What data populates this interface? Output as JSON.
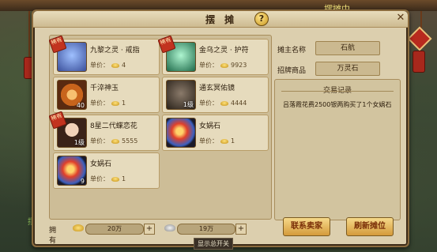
{
  "scene": {
    "top_text": "摆摊中",
    "bottom_text": "摆摊"
  },
  "panel": {
    "title": "摆 摊",
    "help_label": "?",
    "close_label": "✕"
  },
  "labels": {
    "price_label": "单价：",
    "rare_tag": "稀有"
  },
  "items": [
    {
      "name": "九黎之灵 · 戒指",
      "price": "4",
      "count": "",
      "rare": true,
      "icon_color": "#5b7ec9"
    },
    {
      "name": "金乌之灵 · 护符",
      "price": "9923",
      "count": "",
      "rare": true,
      "icon_color": "#2e9c6a"
    },
    {
      "name": "千淬神玉",
      "price": "1",
      "count": "40",
      "rare": false,
      "icon_color": "#c8641c"
    },
    {
      "name": "通玄冥佑镜",
      "price": "4444",
      "count": "1级",
      "rare": false,
      "icon_color": "#5b4a3a"
    },
    {
      "name": "8星二代蝶恋花",
      "price": "5555",
      "count": "1级",
      "rare": true,
      "icon_color": "#c98a6a"
    },
    {
      "name": "女娲石",
      "price": "1",
      "count": "",
      "rare": false,
      "icon_color": "#d0402a"
    },
    {
      "name": "女娲石",
      "price": "1",
      "count": "9",
      "rare": false,
      "icon_color": "#d0402a"
    }
  ],
  "info": {
    "owner_label": "摊主名称",
    "owner_value": "石航",
    "sign_label": "招牌商品",
    "sign_value": "万灵石"
  },
  "log": {
    "title": "交易记录",
    "entries": [
      "吕落霞花费2500银两购买了1个女娲石"
    ]
  },
  "bottom": {
    "own_label": "拥有",
    "gold_value": "20万",
    "silver_value": "19万",
    "plus_label": "+",
    "contact_button": "联系卖家",
    "refresh_button": "刷新摊位",
    "tooltip": "显示总开关"
  },
  "colors": {
    "accent": "#d49a3a",
    "panel_bg": "#dccfae",
    "rare_red": "#c2331f"
  }
}
